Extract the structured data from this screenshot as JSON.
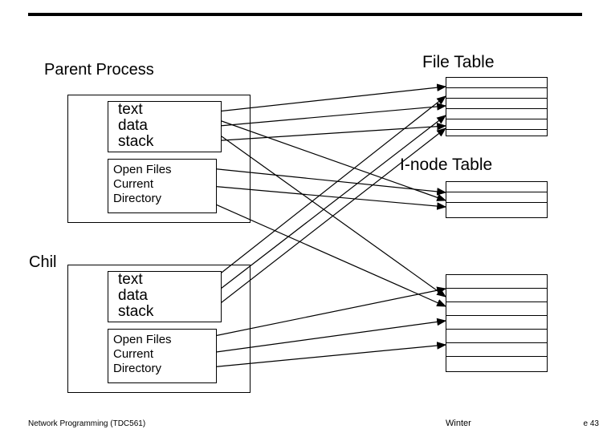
{
  "header": {
    "parent_process": "Parent Process",
    "child_label": "Chil",
    "file_table": "File Table",
    "inode_table": "I-node Table"
  },
  "parent": {
    "seg1": "text",
    "seg2": "data",
    "seg3": "stack",
    "of1": "Open Files",
    "of2": "Current",
    "of3": "Directory"
  },
  "child": {
    "seg1": "text",
    "seg2": "data",
    "seg3": "stack",
    "of1": "Open Files",
    "of2": "  Current",
    "of3": "  Directory"
  },
  "footer": {
    "left": "Network Programming (TDC561)",
    "mid": "Winter",
    "right": "e 43"
  }
}
